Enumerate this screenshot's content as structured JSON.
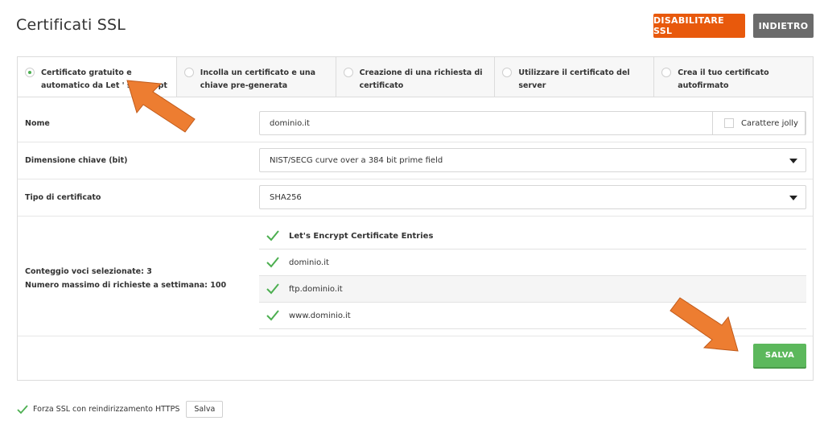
{
  "page": {
    "title": "Certificati SSL"
  },
  "header": {
    "disable_ssl_label": "DISABILITARE SSL",
    "back_label": "INDIETRO"
  },
  "tabs": [
    {
      "label": "Certificato gratuito e automatico da Let ' s Encrypt",
      "selected": true
    },
    {
      "label": "Incolla un certificato e una chiave pre-generata",
      "selected": false
    },
    {
      "label": "Creazione di una richiesta di certificato",
      "selected": false
    },
    {
      "label": "Utilizzare il certificato del server",
      "selected": false
    },
    {
      "label": "Crea il tuo certificato autofirmato",
      "selected": false
    }
  ],
  "form": {
    "name": {
      "label": "Nome",
      "value": "dominio.it",
      "wildcard_label": "Carattere jolly",
      "wildcard_checked": false
    },
    "key_size": {
      "label": "Dimensione chiave (bit)",
      "value": "NIST/SECG curve over a 384 bit prime field"
    },
    "cert_type": {
      "label": "Tipo di certificato",
      "value": "SHA256"
    },
    "selected_count_label": "Conteggio voci selezionate: 3",
    "max_requests_label": "Numero massimo di richieste a settimana: 100",
    "entries": [
      {
        "label": "Let's Encrypt Certificate Entries",
        "checked": true
      },
      {
        "label": "dominio.it",
        "checked": true
      },
      {
        "label": "ftp.dominio.it",
        "checked": true
      },
      {
        "label": "www.dominio.it",
        "checked": true
      }
    ],
    "save_label": "SALVA"
  },
  "footer": {
    "force_ssl_label": "Forza SSL con reindirizzamento HTTPS",
    "force_ssl_checked": true,
    "save_label": "Salva"
  },
  "colors": {
    "accent_orange": "#e8590c",
    "save_green": "#5cb85c",
    "check_green": "#4caf50",
    "annotation_arrow": "#ed7d31"
  }
}
